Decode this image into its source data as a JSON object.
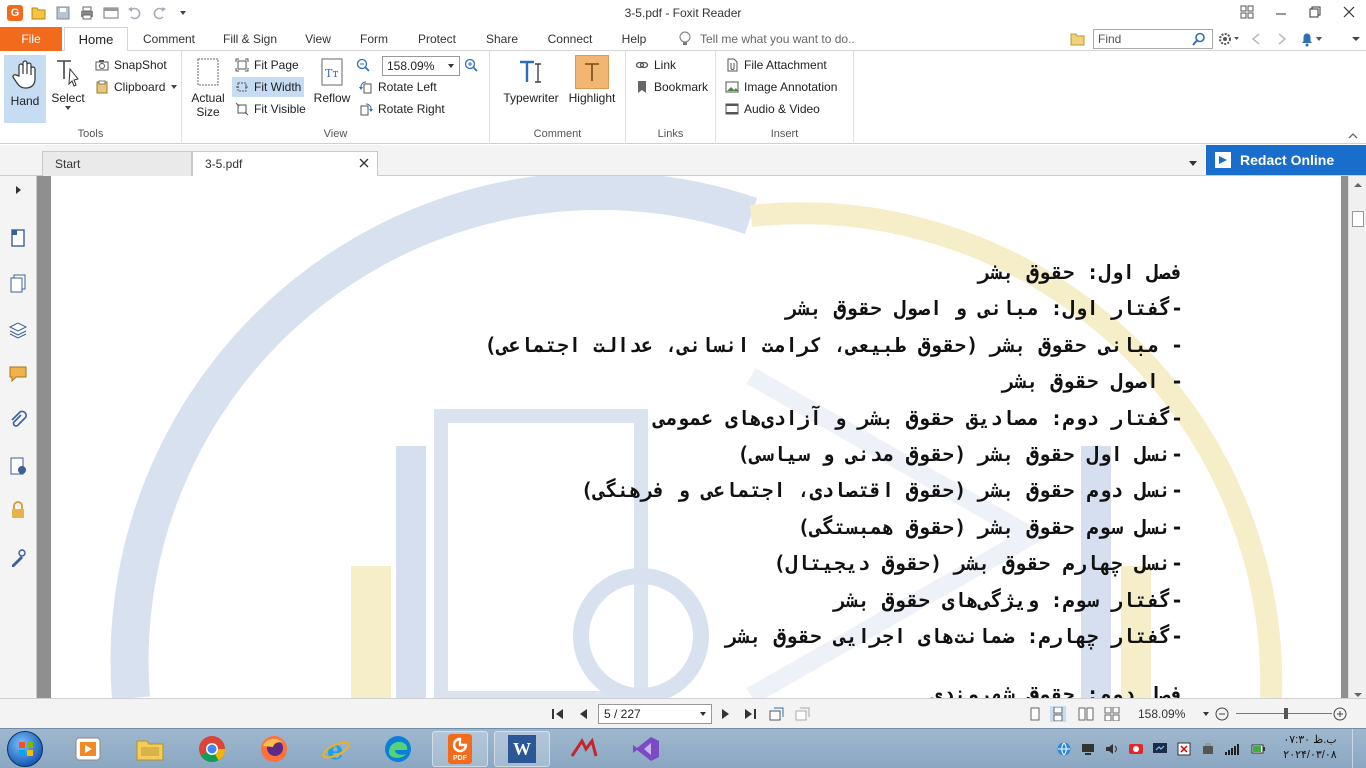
{
  "window": {
    "title": "3-5.pdf - Foxit Reader"
  },
  "quick_access": {
    "icons": [
      "app-logo",
      "open-icon",
      "save-icon",
      "print-icon",
      "window-icon",
      "undo-icon",
      "redo-icon",
      "customize-icon"
    ],
    "logo_letter": "G"
  },
  "ribbon_tabs": {
    "file": "File",
    "home": "Home",
    "comment": "Comment",
    "fill_sign": "Fill & Sign",
    "view": "View",
    "form": "Form",
    "protect": "Protect",
    "share": "Share",
    "connect": "Connect",
    "help": "Help",
    "tell_me_placeholder": "Tell me what you want to do..",
    "find_placeholder": "Find"
  },
  "ribbon": {
    "tools": {
      "group_label": "Tools",
      "hand": "Hand",
      "select": "Select",
      "snapshot": "SnapShot",
      "clipboard": "Clipboard"
    },
    "view": {
      "group_label": "View",
      "actual_size": "Actual Size",
      "fit_page": "Fit Page",
      "fit_width": "Fit Width",
      "fit_visible": "Fit Visible",
      "reflow": "Reflow",
      "zoom_value": "158.09%",
      "rotate_left": "Rotate Left",
      "rotate_right": "Rotate Right"
    },
    "comment": {
      "group_label": "Comment",
      "typewriter": "Typewriter",
      "highlight": "Highlight"
    },
    "links": {
      "group_label": "Links",
      "link": "Link",
      "bookmark": "Bookmark"
    },
    "insert": {
      "group_label": "Insert",
      "file_attachment": "File Attachment",
      "image_annotation": "Image Annotation",
      "audio_video": "Audio & Video"
    }
  },
  "doc_tabs": {
    "start": "Start",
    "current": "3-5.pdf",
    "redact_online": "Redact Online"
  },
  "left_nav": {
    "icons": [
      "expand-arrow-icon",
      "page-thumbnails-icon",
      "pages-icon",
      "layers-icon",
      "comments-icon",
      "attachments-icon",
      "signatures-icon",
      "security-icon",
      "content-icon"
    ]
  },
  "document": {
    "lines": [
      "فصل اول: حقوق بشر",
      "-گفتار اول: مبانی و اصول حقوق بشر",
      "- مبانی حقوق بشر (حقوق طبیعی، کرامت انسانی، عدالت اجتماعی)",
      "- اصول حقوق بشر",
      "-گفتار دوم: مصادیق حقوق بشر و آزادی‌های عمومی",
      "-نسل اول حقوق بشر (حقوق مدنی و سیاسی)",
      "-نسل دوم حقوق بشر (حقوق اقتصادی، اجتماعی و فرهنگی)",
      "-نسل سوم حقوق بشر (حقوق همبستگی)",
      "-نسل چهارم حقوق بشر (حقوق دیجیتال)",
      "-گفتار سوم: ویژگی‌های حقوق بشر",
      "-گفتار چهارم: ضمانت‌های اجرایی حقوق بشر"
    ],
    "partial_line": "فصل دوم: حقوق شهروندی"
  },
  "statusbar": {
    "page_value": "5 / 227",
    "zoom_label": "158.09%",
    "zoom_fraction": 0.52
  },
  "taskbar": {
    "apps": [
      "start-button",
      "media-player",
      "file-explorer",
      "chrome",
      "firefox",
      "internet-explorer",
      "edge",
      "foxit-reader",
      "word",
      "app-red",
      "visual-studio"
    ],
    "foxit_label": "PDF",
    "word_letter": "W",
    "clock_time": "۰۷:۳۰ ب.ظ",
    "clock_date": "۲۰۲۴/۰۳/۰۸"
  },
  "colors": {
    "accent_orange": "#f26b1d",
    "redact_blue": "#1a6ecb",
    "active_blue": "#c5dcf2"
  }
}
